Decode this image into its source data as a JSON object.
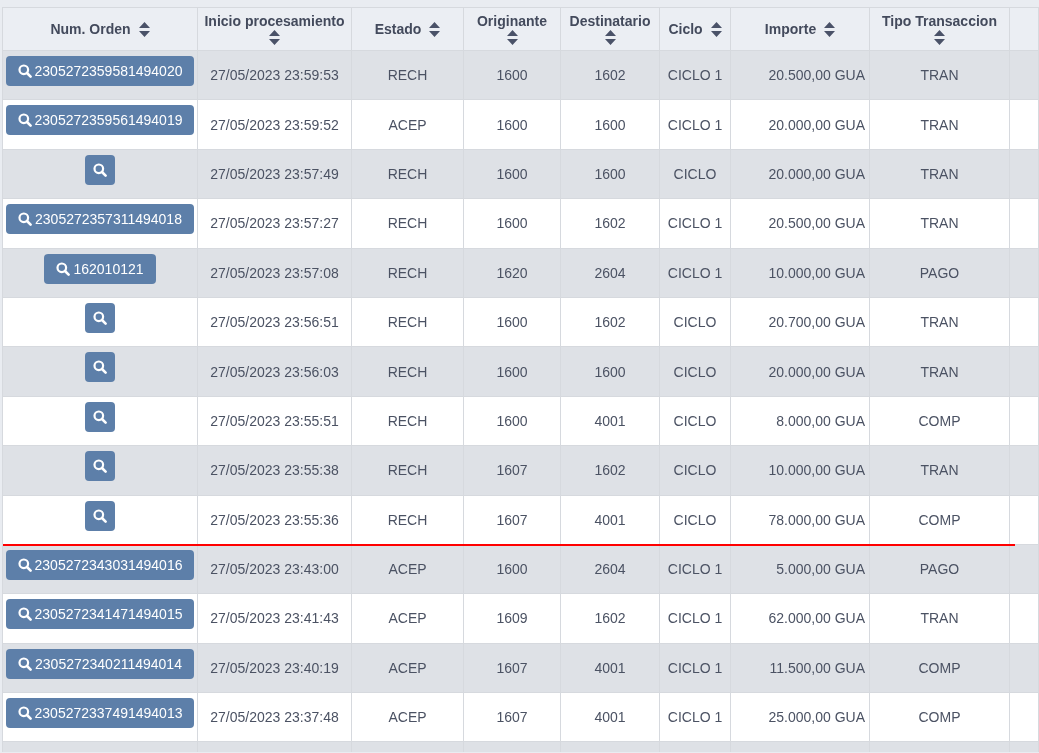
{
  "table": {
    "columns": [
      {
        "label": "Num. Orden"
      },
      {
        "label": "Inicio procesamiento"
      },
      {
        "label": "Estado"
      },
      {
        "label": "Originante"
      },
      {
        "label": "Destinatario"
      },
      {
        "label": "Ciclo"
      },
      {
        "label": "Importe"
      },
      {
        "label": "Tipo Transaccion"
      }
    ],
    "rows": [
      {
        "num_orden": "2305272359581494020",
        "inicio_procesamiento": "27/05/2023 23:59:53",
        "estado": "RECH",
        "originante": "1600",
        "destinatario": "1602",
        "ciclo": "CICLO 1",
        "importe": "20.500,00 GUA",
        "tipo_transaccion": "TRAN",
        "divider_below": false
      },
      {
        "num_orden": "2305272359561494019",
        "inicio_procesamiento": "27/05/2023 23:59:52",
        "estado": "ACEP",
        "originante": "1600",
        "destinatario": "1600",
        "ciclo": "CICLO 1",
        "importe": "20.000,00 GUA",
        "tipo_transaccion": "TRAN",
        "divider_below": false
      },
      {
        "inicio_procesamiento": "27/05/2023 23:57:49",
        "estado": "RECH",
        "originante": "1600",
        "destinatario": "1600",
        "ciclo": "CICLO",
        "importe": "20.000,00 GUA",
        "tipo_transaccion": "TRAN",
        "divider_below": false
      },
      {
        "num_orden": "2305272357311494018",
        "inicio_procesamiento": "27/05/2023 23:57:27",
        "estado": "RECH",
        "originante": "1600",
        "destinatario": "1602",
        "ciclo": "CICLO 1",
        "importe": "20.500,00 GUA",
        "tipo_transaccion": "TRAN",
        "divider_below": false
      },
      {
        "num_orden": "162010121",
        "inicio_procesamiento": "27/05/2023 23:57:08",
        "estado": "RECH",
        "originante": "1620",
        "destinatario": "2604",
        "ciclo": "CICLO 1",
        "importe": "10.000,00 GUA",
        "tipo_transaccion": "PAGO",
        "divider_below": false
      },
      {
        "inicio_procesamiento": "27/05/2023 23:56:51",
        "estado": "RECH",
        "originante": "1600",
        "destinatario": "1602",
        "ciclo": "CICLO",
        "importe": "20.700,00 GUA",
        "tipo_transaccion": "TRAN",
        "divider_below": false
      },
      {
        "inicio_procesamiento": "27/05/2023 23:56:03",
        "estado": "RECH",
        "originante": "1600",
        "destinatario": "1600",
        "ciclo": "CICLO",
        "importe": "20.000,00 GUA",
        "tipo_transaccion": "TRAN",
        "divider_below": false
      },
      {
        "inicio_procesamiento": "27/05/2023 23:55:51",
        "estado": "RECH",
        "originante": "1600",
        "destinatario": "4001",
        "ciclo": "CICLO",
        "importe": "8.000,00 GUA",
        "tipo_transaccion": "COMP",
        "divider_below": false
      },
      {
        "inicio_procesamiento": "27/05/2023 23:55:38",
        "estado": "RECH",
        "originante": "1607",
        "destinatario": "1602",
        "ciclo": "CICLO",
        "importe": "10.000,00 GUA",
        "tipo_transaccion": "TRAN",
        "divider_below": false
      },
      {
        "inicio_procesamiento": "27/05/2023 23:55:36",
        "estado": "RECH",
        "originante": "1607",
        "destinatario": "4001",
        "ciclo": "CICLO",
        "importe": "78.000,00 GUA",
        "tipo_transaccion": "COMP",
        "divider_below": true
      },
      {
        "num_orden": "2305272343031494016",
        "inicio_procesamiento": "27/05/2023 23:43:00",
        "estado": "ACEP",
        "originante": "1600",
        "destinatario": "2604",
        "ciclo": "CICLO 1",
        "importe": "5.000,00 GUA",
        "tipo_transaccion": "PAGO",
        "divider_below": false
      },
      {
        "num_orden": "2305272341471494015",
        "inicio_procesamiento": "27/05/2023 23:41:43",
        "estado": "ACEP",
        "originante": "1609",
        "destinatario": "1602",
        "ciclo": "CICLO 1",
        "importe": "62.000,00 GUA",
        "tipo_transaccion": "TRAN",
        "divider_below": false
      },
      {
        "num_orden": "2305272340211494014",
        "inicio_procesamiento": "27/05/2023 23:40:19",
        "estado": "ACEP",
        "originante": "1607",
        "destinatario": "4001",
        "ciclo": "CICLO 1",
        "importe": "11.500,00 GUA",
        "tipo_transaccion": "COMP",
        "divider_below": false
      },
      {
        "num_orden": "2305272337491494013",
        "inicio_procesamiento": "27/05/2023 23:37:48",
        "estado": "ACEP",
        "originante": "1607",
        "destinatario": "4001",
        "ciclo": "CICLO 1",
        "importe": "25.000,00 GUA",
        "tipo_transaccion": "COMP",
        "divider_below": false
      }
    ]
  }
}
